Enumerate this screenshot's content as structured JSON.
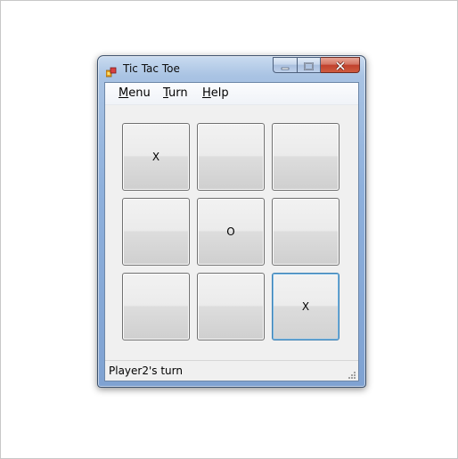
{
  "window": {
    "title": "Tic Tac Toe",
    "icon": "app-icon",
    "controls": [
      "minimize-icon",
      "maximize-icon",
      "close-icon"
    ]
  },
  "menu": {
    "items": [
      {
        "accel": "M",
        "rest": "enu"
      },
      {
        "accel": "T",
        "rest": "urn"
      },
      {
        "accel": "H",
        "rest": "elp"
      }
    ]
  },
  "board": {
    "cells": [
      "X",
      "",
      "",
      "",
      "O",
      "",
      "",
      "",
      "X"
    ],
    "focused_cell": 8
  },
  "status": {
    "text": "Player2's turn"
  },
  "colors": {
    "title_bar": "#8eb0dc",
    "close_button": "#c0412c",
    "focus_border": "#3c7fb1"
  }
}
